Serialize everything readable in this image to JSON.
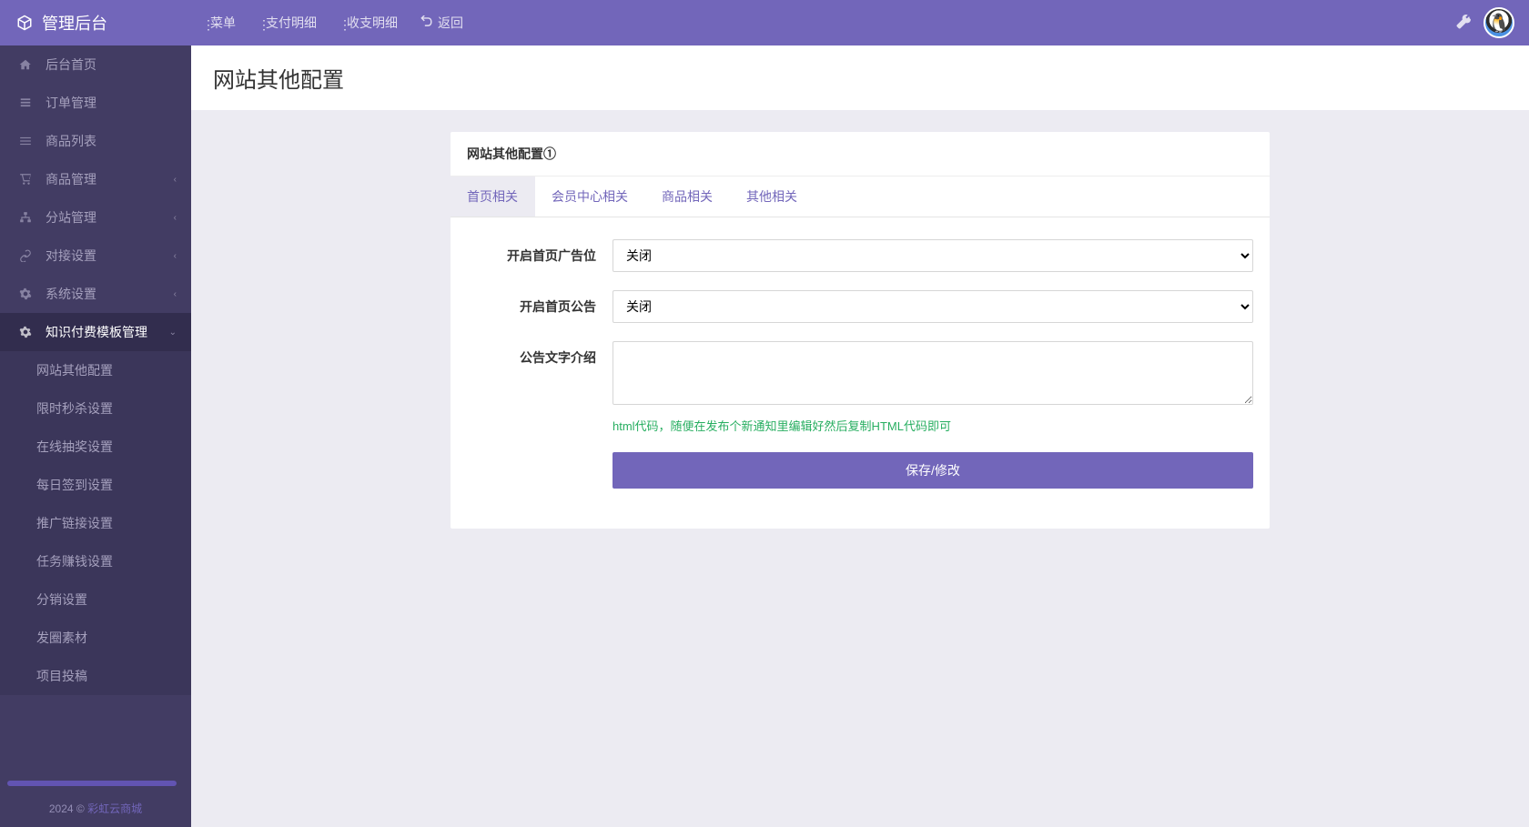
{
  "header": {
    "brand": "管理后台",
    "menu": [
      {
        "label": "菜单"
      },
      {
        "label": "支付明细"
      },
      {
        "label": "收支明细"
      },
      {
        "label": "返回",
        "return": true
      }
    ]
  },
  "sidebar": {
    "items": [
      {
        "label": "后台首页"
      },
      {
        "label": "订单管理"
      },
      {
        "label": "商品列表"
      },
      {
        "label": "商品管理",
        "expandable": true
      },
      {
        "label": "分站管理",
        "expandable": true
      },
      {
        "label": "对接设置",
        "expandable": true
      },
      {
        "label": "系统设置",
        "expandable": true
      },
      {
        "label": "知识付费模板管理",
        "expandable": true,
        "active": true
      }
    ],
    "sub": [
      {
        "label": "网站其他配置"
      },
      {
        "label": "限时秒杀设置"
      },
      {
        "label": "在线抽奖设置"
      },
      {
        "label": "每日签到设置"
      },
      {
        "label": "推广链接设置"
      },
      {
        "label": "任务赚钱设置"
      },
      {
        "label": "分销设置"
      },
      {
        "label": "发圈素材"
      },
      {
        "label": "项目投稿"
      }
    ]
  },
  "footer": {
    "year": "2024 © ",
    "link": "彩虹云商城"
  },
  "page": {
    "title": "网站其他配置",
    "panel_title": "网站其他配置①",
    "tabs": [
      "首页相关",
      "会员中心相关",
      "商品相关",
      "其他相关"
    ],
    "form": {
      "ad_label": "开启首页广告位",
      "ad_value": "关闭",
      "notice_label": "开启首页公告",
      "notice_value": "关闭",
      "notice_text_label": "公告文字介绍",
      "notice_text_value": "",
      "notice_help": "html代码，随便在发布个新通知里编辑好然后复制HTML代码即可",
      "submit": "保存/修改"
    }
  }
}
